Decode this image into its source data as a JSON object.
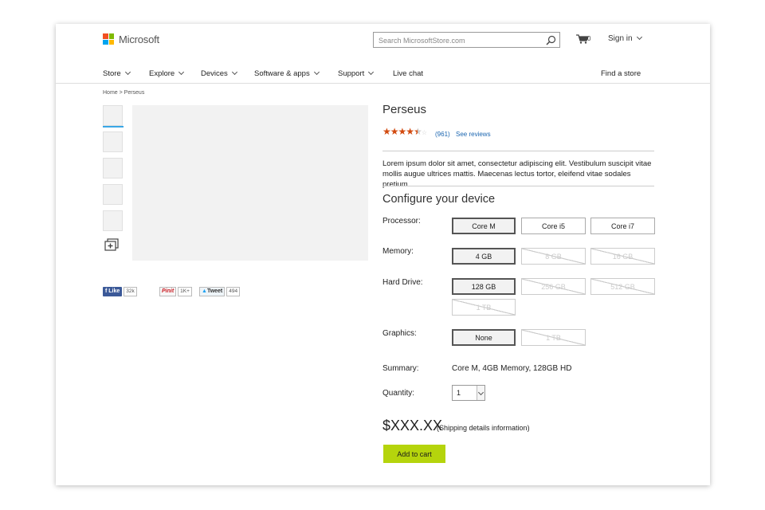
{
  "header": {
    "brand": "Microsoft",
    "logo_colors": [
      "#f25022",
      "#7fba00",
      "#00a4ef",
      "#ffb900"
    ],
    "search_placeholder": "Search MicrosoftStore.com",
    "cart_count": "0",
    "sign_in": "Sign in"
  },
  "nav": {
    "items": [
      {
        "label": "Store"
      },
      {
        "label": "Explore"
      },
      {
        "label": "Devices"
      },
      {
        "label": "Software & apps"
      },
      {
        "label": "Support"
      },
      {
        "label": "Live chat"
      }
    ],
    "find_store": "Find a store"
  },
  "breadcrumb": "Home > Perseus",
  "social": {
    "like_label": "Like",
    "like_count": "32k",
    "pin_label": "Pinit",
    "pin_count": "1K+",
    "tweet_label": "Tweet",
    "tweet_count": "494"
  },
  "product": {
    "title": "Perseus",
    "rating": 4.5,
    "rating_count": "(961)",
    "see_reviews": "See reviews",
    "description": "Lorem ipsum dolor sit amet, consectetur adipiscing elit. Vestibulum suscipit vitae mollis augue ultrices mattis. Maecenas lectus tortor, eleifend vitae sodales pretium.",
    "configure_title": "Configure your device",
    "accent_color": "#b5d40c",
    "star_color": "#d24b10"
  },
  "config": {
    "processor_label": "Processor:",
    "processor_options": [
      "Core M",
      "Core i5",
      "Core i7"
    ],
    "memory_label": "Memory:",
    "memory_options": [
      "4 GB",
      "8 GB",
      "16 GB"
    ],
    "harddrive_label": "Hard Drive:",
    "harddrive_options": [
      "128 GB",
      "256 GB",
      "512 GB",
      "1 TB"
    ],
    "graphics_label": "Graphics:",
    "graphics_options": [
      "None",
      "1 TB"
    ]
  },
  "summary": {
    "label": "Summary:",
    "value": "Core M, 4GB Memory, 128GB HD"
  },
  "quantity": {
    "label": "Quantity:",
    "value": "1"
  },
  "price": {
    "amount": "$XXX.XX",
    "shipping": "(Shipping details information)"
  },
  "add_to_cart": "Add to cart"
}
